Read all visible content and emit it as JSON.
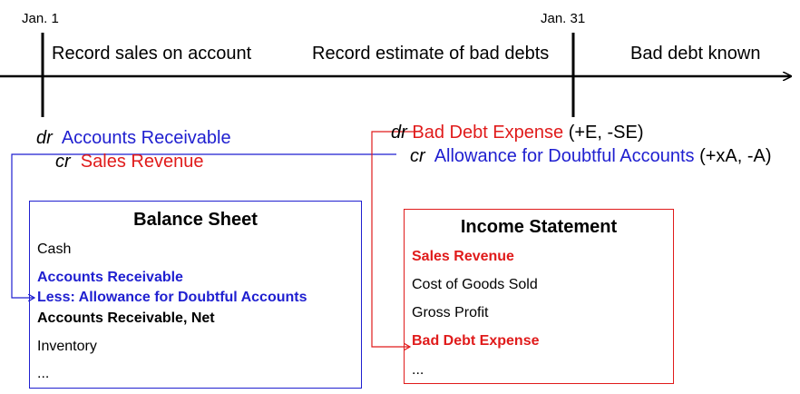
{
  "timeline": {
    "date_start": "Jan. 1",
    "date_end": "Jan. 31",
    "phases": [
      "Record sales on account",
      "Record estimate of bad debts",
      "Bad debt known"
    ]
  },
  "entry_sale": {
    "dr_prefix": "dr",
    "dr_account": "Accounts Receivable",
    "cr_prefix": "cr",
    "cr_account": "Sales Revenue"
  },
  "entry_estimate": {
    "dr_prefix": "dr",
    "dr_account": "Bad Debt Expense",
    "dr_effect": "(+E, -SE)",
    "cr_prefix": "cr",
    "cr_account": "Allowance for Doubtful Accounts",
    "cr_effect": "(+xA, -A)"
  },
  "balance_sheet": {
    "title": "Balance Sheet",
    "rows": [
      "Cash",
      "Accounts Receivable",
      "Less: Allowance for Doubtful Accounts",
      "Accounts Receivable, Net",
      "Inventory",
      "..."
    ]
  },
  "income_statement": {
    "title": "Income Statement",
    "rows": [
      "Sales Revenue",
      "Cost of Goods Sold",
      "Gross Profit",
      "Bad Debt Expense",
      "..."
    ]
  },
  "colors": {
    "blue": "#1f1fd0",
    "red": "#e01b1b",
    "black": "#000000"
  }
}
